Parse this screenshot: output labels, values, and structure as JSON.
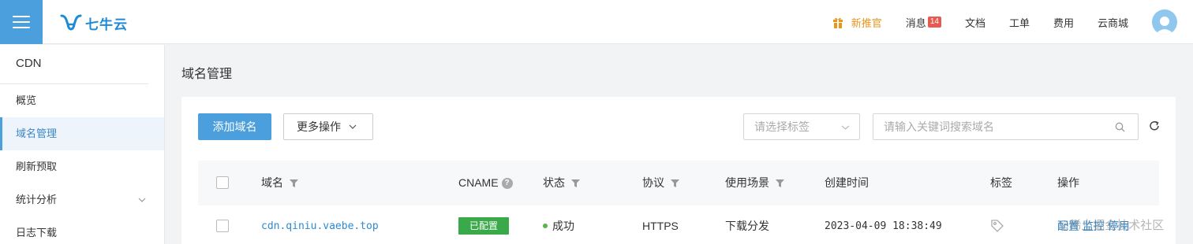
{
  "header": {
    "logo_text": "七牛云",
    "nav": {
      "promo": "新推官",
      "messages": "消息",
      "message_count": "14",
      "docs": "文档",
      "tickets": "工单",
      "billing": "费用",
      "marketplace": "云商城"
    }
  },
  "sidebar": {
    "title": "CDN",
    "items": [
      {
        "label": "概览",
        "active": false
      },
      {
        "label": "域名管理",
        "active": true
      },
      {
        "label": "刷新预取",
        "active": false
      },
      {
        "label": "统计分析",
        "active": false,
        "expandable": true
      },
      {
        "label": "日志下载",
        "active": false
      }
    ]
  },
  "main": {
    "page_title": "域名管理",
    "toolbar": {
      "add_label": "添加域名",
      "more_label": "更多操作",
      "tag_placeholder": "请选择标签",
      "search_placeholder": "请输入关键词搜索域名"
    },
    "table": {
      "columns": {
        "domain": "域名",
        "cname": "CNAME",
        "status": "状态",
        "protocol": "协议",
        "scenario": "使用场景",
        "created": "创建时间",
        "tags": "标签",
        "actions": "操作"
      },
      "rows": [
        {
          "domain": "cdn.qiniu.vaebe.top",
          "cname": "已配置",
          "status": "成功",
          "protocol": "HTTPS",
          "scenario": "下载分发",
          "created": "2023-04-09 18:38:49",
          "actions": "配置 监控 停用"
        }
      ]
    }
  },
  "watermark": "@稀土掘金技术社区",
  "colors": {
    "accent": "#4a9fdc",
    "link": "#2d8ad2",
    "success": "#3aa94a",
    "promo": "#e8961c",
    "badge": "#e85a4f"
  }
}
